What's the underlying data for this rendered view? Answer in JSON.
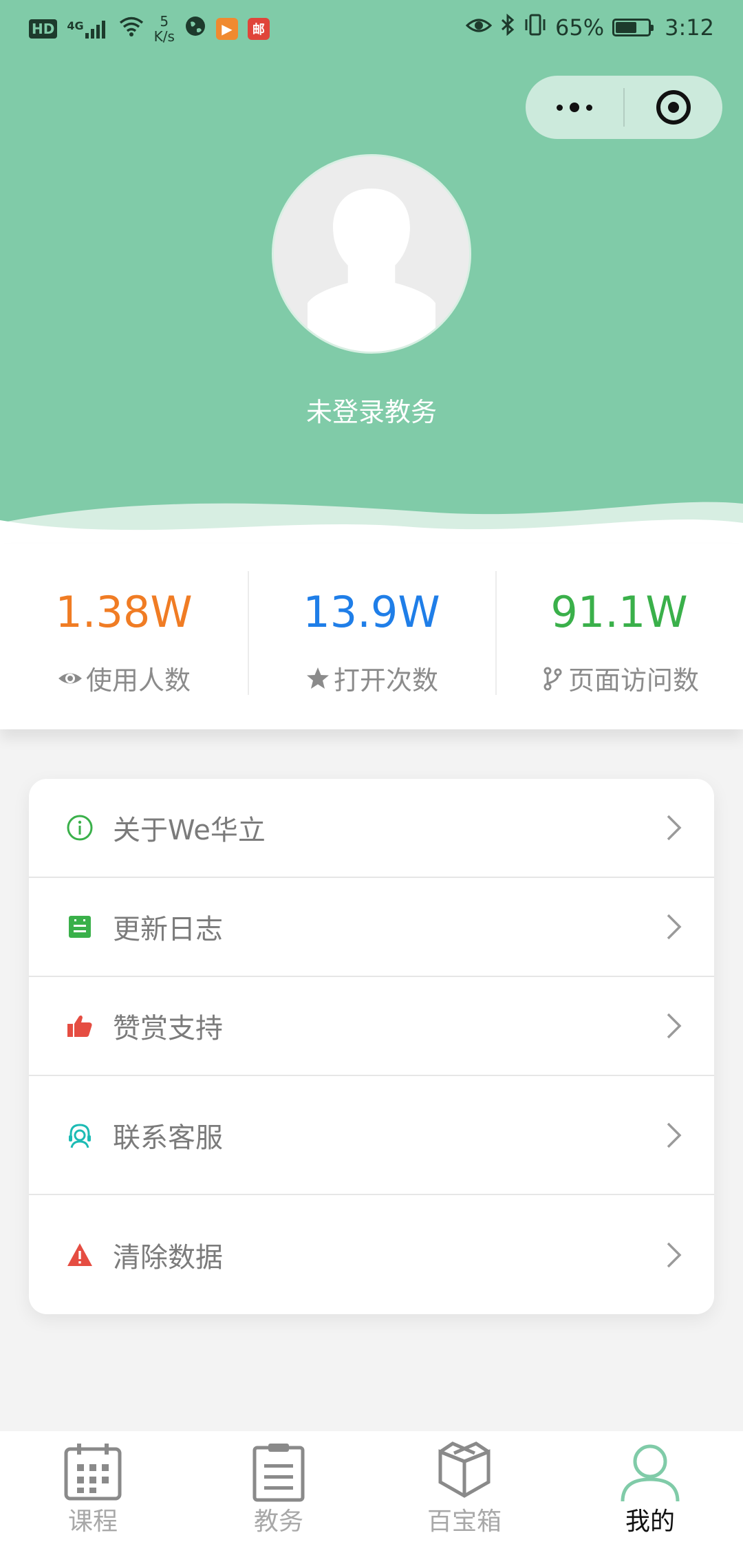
{
  "status_bar": {
    "left_badge": "HD",
    "network": "4G",
    "speed_value": "5",
    "speed_unit": "K/s",
    "battery_percent": "65%",
    "time": "3:12",
    "icons": [
      "hd-icon",
      "signal-icon",
      "wifi-icon",
      "globe-icon",
      "play-icon",
      "mail-icon",
      "eye-icon",
      "bluetooth-icon",
      "vibrate-icon",
      "battery-icon"
    ]
  },
  "header": {
    "username": "未登录教务",
    "background_color": "#80cba8"
  },
  "stats": [
    {
      "value": "1.38W",
      "label": "使用人数",
      "color": "#f07c24",
      "icon": "eye-icon"
    },
    {
      "value": "13.9W",
      "label": "打开次数",
      "color": "#1f7ee8",
      "icon": "star-icon"
    },
    {
      "value": "91.1W",
      "label": "页面访问数",
      "color": "#3ab04a",
      "icon": "branch-icon"
    }
  ],
  "menu": [
    {
      "label": "关于We华立",
      "icon": "info-icon",
      "icon_color": "#3ab04a"
    },
    {
      "label": "更新日志",
      "icon": "notebook-icon",
      "icon_color": "#3ab04a"
    },
    {
      "label": "赞赏支持",
      "icon": "thumbs-up-icon",
      "icon_color": "#e54d42"
    },
    {
      "label": "联系客服",
      "icon": "headset-icon",
      "icon_color": "#1cbbb4"
    },
    {
      "label": "清除数据",
      "icon": "warning-icon",
      "icon_color": "#e54d42"
    }
  ],
  "tabbar": [
    {
      "label": "课程",
      "icon": "calendar-icon",
      "active": false
    },
    {
      "label": "教务",
      "icon": "clipboard-icon",
      "active": false
    },
    {
      "label": "百宝箱",
      "icon": "box-icon",
      "active": false
    },
    {
      "label": "我的",
      "icon": "user-icon",
      "active": true
    }
  ]
}
